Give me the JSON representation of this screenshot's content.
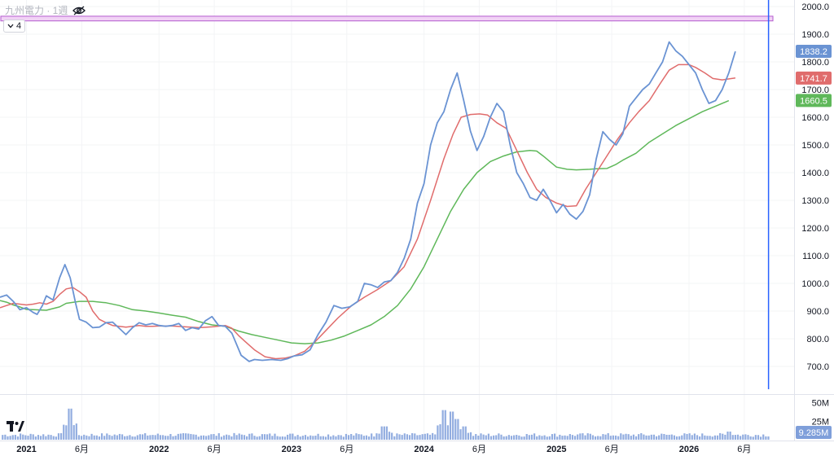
{
  "legend": {
    "symbol_text": "九州電力 · 1週",
    "collapse_count": "4"
  },
  "colors": {
    "price": "#6a93d3",
    "ma_short": "#e06c6c",
    "ma_long": "#5fb85a",
    "volume": "#7f9fda",
    "crosshair": "#2962ff",
    "highlight_fill": "#f1d2f5",
    "highlight_stroke": "#b35ccf"
  },
  "chart_data": {
    "type": "line",
    "x_axis": {
      "ticks": [
        {
          "label": "2021",
          "x": 2021.0
        },
        {
          "label": "6月",
          "x": 2021.417
        },
        {
          "label": "2022",
          "x": 2022.0
        },
        {
          "label": "6月",
          "x": 2022.417
        },
        {
          "label": "2023",
          "x": 2023.0
        },
        {
          "label": "6月",
          "x": 2023.417
        },
        {
          "label": "2024",
          "x": 2024.0
        },
        {
          "label": "6月",
          "x": 2024.417
        },
        {
          "label": "2025",
          "x": 2025.0
        },
        {
          "label": "6月",
          "x": 2025.417
        },
        {
          "label": "2026",
          "x": 2026.0
        },
        {
          "label": "6月",
          "x": 2026.417
        }
      ]
    },
    "y_axis": {
      "range": [
        620,
        2000
      ],
      "ticks": [
        {
          "label": "2000.0",
          "value": 2000
        },
        {
          "label": "1900.0",
          "value": 1900
        },
        {
          "label": "1800.0",
          "value": 1800
        },
        {
          "label": "1700.0",
          "value": 1700
        },
        {
          "label": "1600.0",
          "value": 1600
        },
        {
          "label": "1500.0",
          "value": 1500
        },
        {
          "label": "1400.0",
          "value": 1400
        },
        {
          "label": "1300.0",
          "value": 1300
        },
        {
          "label": "1200.0",
          "value": 1200
        },
        {
          "label": "1100.0",
          "value": 1100
        },
        {
          "label": "1000.0",
          "value": 1000
        },
        {
          "label": "900.0",
          "value": 900
        },
        {
          "label": "800.0",
          "value": 800
        },
        {
          "label": "700.0",
          "value": 700
        }
      ]
    },
    "volume_axis": {
      "max": 55,
      "ticks": [
        {
          "label": "50M",
          "value": 50
        },
        {
          "label": "25M",
          "value": 25
        }
      ]
    },
    "highlight_band": {
      "low": 1948,
      "high": 1965
    },
    "crosshair_x": 2026.6,
    "price_labels": [
      {
        "label": "1838.2",
        "value": 1838.2,
        "series": "price"
      },
      {
        "label": "1741.7",
        "value": 1741.7,
        "series": "ma_short"
      },
      {
        "label": "1660.5",
        "value": 1660.5,
        "series": "ma_long"
      }
    ],
    "volume_label": {
      "label": "9.285M",
      "value": 9.285
    },
    "series": [
      {
        "key": "price",
        "points": [
          [
            2020.8,
            950
          ],
          [
            2020.85,
            958
          ],
          [
            2020.9,
            935
          ],
          [
            2020.95,
            905
          ],
          [
            2021.0,
            912
          ],
          [
            2021.05,
            895
          ],
          [
            2021.08,
            888
          ],
          [
            2021.12,
            920
          ],
          [
            2021.15,
            955
          ],
          [
            2021.2,
            940
          ],
          [
            2021.25,
            1020
          ],
          [
            2021.29,
            1068
          ],
          [
            2021.33,
            1020
          ],
          [
            2021.37,
            930
          ],
          [
            2021.4,
            870
          ],
          [
            2021.45,
            860
          ],
          [
            2021.5,
            840
          ],
          [
            2021.55,
            842
          ],
          [
            2021.6,
            858
          ],
          [
            2021.65,
            860
          ],
          [
            2021.7,
            838
          ],
          [
            2021.75,
            815
          ],
          [
            2021.8,
            840
          ],
          [
            2021.85,
            858
          ],
          [
            2021.9,
            850
          ],
          [
            2021.95,
            855
          ],
          [
            2022.0,
            848
          ],
          [
            2022.05,
            845
          ],
          [
            2022.1,
            848
          ],
          [
            2022.15,
            855
          ],
          [
            2022.2,
            830
          ],
          [
            2022.25,
            840
          ],
          [
            2022.3,
            835
          ],
          [
            2022.35,
            865
          ],
          [
            2022.4,
            880
          ],
          [
            2022.45,
            848
          ],
          [
            2022.5,
            845
          ],
          [
            2022.55,
            820
          ],
          [
            2022.62,
            740
          ],
          [
            2022.68,
            718
          ],
          [
            2022.72,
            725
          ],
          [
            2022.78,
            722
          ],
          [
            2022.85,
            725
          ],
          [
            2022.92,
            722
          ],
          [
            2022.97,
            728
          ],
          [
            2023.02,
            738
          ],
          [
            2023.08,
            742
          ],
          [
            2023.14,
            760
          ],
          [
            2023.2,
            815
          ],
          [
            2023.26,
            860
          ],
          [
            2023.32,
            920
          ],
          [
            2023.38,
            910
          ],
          [
            2023.44,
            915
          ],
          [
            2023.5,
            935
          ],
          [
            2023.55,
            1000
          ],
          [
            2023.6,
            995
          ],
          [
            2023.65,
            985
          ],
          [
            2023.7,
            1005
          ],
          [
            2023.75,
            1010
          ],
          [
            2023.8,
            1040
          ],
          [
            2023.85,
            1090
          ],
          [
            2023.9,
            1160
          ],
          [
            2023.95,
            1290
          ],
          [
            2024.0,
            1360
          ],
          [
            2024.05,
            1500
          ],
          [
            2024.1,
            1580
          ],
          [
            2024.15,
            1620
          ],
          [
            2024.2,
            1700
          ],
          [
            2024.25,
            1760
          ],
          [
            2024.3,
            1660
          ],
          [
            2024.35,
            1550
          ],
          [
            2024.4,
            1480
          ],
          [
            2024.45,
            1530
          ],
          [
            2024.5,
            1600
          ],
          [
            2024.55,
            1650
          ],
          [
            2024.6,
            1620
          ],
          [
            2024.65,
            1500
          ],
          [
            2024.7,
            1400
          ],
          [
            2024.75,
            1360
          ],
          [
            2024.8,
            1310
          ],
          [
            2024.85,
            1300
          ],
          [
            2024.9,
            1340
          ],
          [
            2024.95,
            1300
          ],
          [
            2025.0,
            1255
          ],
          [
            2025.05,
            1285
          ],
          [
            2025.1,
            1250
          ],
          [
            2025.15,
            1232
          ],
          [
            2025.2,
            1260
          ],
          [
            2025.25,
            1320
          ],
          [
            2025.3,
            1450
          ],
          [
            2025.35,
            1548
          ],
          [
            2025.4,
            1520
          ],
          [
            2025.45,
            1500
          ],
          [
            2025.5,
            1540
          ],
          [
            2025.55,
            1640
          ],
          [
            2025.6,
            1670
          ],
          [
            2025.65,
            1700
          ],
          [
            2025.7,
            1720
          ],
          [
            2025.75,
            1760
          ],
          [
            2025.8,
            1800
          ],
          [
            2025.85,
            1872
          ],
          [
            2025.9,
            1840
          ],
          [
            2025.95,
            1820
          ],
          [
            2026.0,
            1790
          ],
          [
            2026.05,
            1760
          ],
          [
            2026.1,
            1700
          ],
          [
            2026.15,
            1650
          ],
          [
            2026.2,
            1660
          ],
          [
            2026.25,
            1700
          ],
          [
            2026.3,
            1760
          ],
          [
            2026.35,
            1838
          ]
        ]
      },
      {
        "key": "ma_short",
        "points": [
          [
            2020.8,
            912
          ],
          [
            2020.85,
            920
          ],
          [
            2020.9,
            928
          ],
          [
            2020.95,
            925
          ],
          [
            2021.0,
            922
          ],
          [
            2021.05,
            925
          ],
          [
            2021.1,
            930
          ],
          [
            2021.15,
            925
          ],
          [
            2021.2,
            935
          ],
          [
            2021.25,
            960
          ],
          [
            2021.3,
            980
          ],
          [
            2021.35,
            985
          ],
          [
            2021.4,
            970
          ],
          [
            2021.45,
            950
          ],
          [
            2021.5,
            900
          ],
          [
            2021.55,
            870
          ],
          [
            2021.6,
            858
          ],
          [
            2021.65,
            848
          ],
          [
            2021.7,
            845
          ],
          [
            2021.75,
            842
          ],
          [
            2021.8,
            845
          ],
          [
            2021.85,
            848
          ],
          [
            2021.9,
            845
          ],
          [
            2021.95,
            845
          ],
          [
            2022.0,
            846
          ],
          [
            2022.1,
            846
          ],
          [
            2022.2,
            843
          ],
          [
            2022.3,
            840
          ],
          [
            2022.4,
            843
          ],
          [
            2022.5,
            848
          ],
          [
            2022.55,
            838
          ],
          [
            2022.6,
            812
          ],
          [
            2022.65,
            790
          ],
          [
            2022.72,
            760
          ],
          [
            2022.8,
            735
          ],
          [
            2022.88,
            728
          ],
          [
            2022.95,
            730
          ],
          [
            2023.02,
            738
          ],
          [
            2023.1,
            755
          ],
          [
            2023.18,
            790
          ],
          [
            2023.26,
            830
          ],
          [
            2023.35,
            875
          ],
          [
            2023.45,
            918
          ],
          [
            2023.55,
            950
          ],
          [
            2023.65,
            978
          ],
          [
            2023.75,
            1010
          ],
          [
            2023.85,
            1060
          ],
          [
            2023.95,
            1160
          ],
          [
            2024.05,
            1300
          ],
          [
            2024.15,
            1450
          ],
          [
            2024.22,
            1540
          ],
          [
            2024.28,
            1600
          ],
          [
            2024.35,
            1610
          ],
          [
            2024.42,
            1612
          ],
          [
            2024.48,
            1608
          ],
          [
            2024.55,
            1580
          ],
          [
            2024.62,
            1560
          ],
          [
            2024.7,
            1480
          ],
          [
            2024.78,
            1400
          ],
          [
            2024.85,
            1340
          ],
          [
            2024.92,
            1310
          ],
          [
            2025.0,
            1290
          ],
          [
            2025.08,
            1278
          ],
          [
            2025.15,
            1280
          ],
          [
            2025.22,
            1340
          ],
          [
            2025.3,
            1400
          ],
          [
            2025.38,
            1460
          ],
          [
            2025.46,
            1520
          ],
          [
            2025.55,
            1580
          ],
          [
            2025.62,
            1620
          ],
          [
            2025.7,
            1660
          ],
          [
            2025.78,
            1720
          ],
          [
            2025.85,
            1770
          ],
          [
            2025.92,
            1790
          ],
          [
            2026.0,
            1790
          ],
          [
            2026.05,
            1780
          ],
          [
            2026.12,
            1760
          ],
          [
            2026.18,
            1740
          ],
          [
            2026.25,
            1735
          ],
          [
            2026.35,
            1742
          ]
        ]
      },
      {
        "key": "ma_long",
        "points": [
          [
            2020.8,
            938
          ],
          [
            2020.85,
            932
          ],
          [
            2020.9,
            922
          ],
          [
            2020.95,
            915
          ],
          [
            2021.0,
            906
          ],
          [
            2021.05,
            905
          ],
          [
            2021.15,
            903
          ],
          [
            2021.25,
            915
          ],
          [
            2021.3,
            928
          ],
          [
            2021.4,
            935
          ],
          [
            2021.5,
            935
          ],
          [
            2021.6,
            930
          ],
          [
            2021.7,
            920
          ],
          [
            2021.8,
            905
          ],
          [
            2021.9,
            900
          ],
          [
            2022.0,
            893
          ],
          [
            2022.1,
            885
          ],
          [
            2022.2,
            878
          ],
          [
            2022.3,
            862
          ],
          [
            2022.4,
            850
          ],
          [
            2022.5,
            845
          ],
          [
            2022.6,
            828
          ],
          [
            2022.7,
            815
          ],
          [
            2022.8,
            805
          ],
          [
            2022.9,
            795
          ],
          [
            2023.0,
            785
          ],
          [
            2023.1,
            782
          ],
          [
            2023.2,
            785
          ],
          [
            2023.3,
            795
          ],
          [
            2023.4,
            810
          ],
          [
            2023.5,
            830
          ],
          [
            2023.6,
            850
          ],
          [
            2023.7,
            880
          ],
          [
            2023.8,
            920
          ],
          [
            2023.9,
            980
          ],
          [
            2024.0,
            1060
          ],
          [
            2024.1,
            1160
          ],
          [
            2024.2,
            1260
          ],
          [
            2024.3,
            1340
          ],
          [
            2024.4,
            1400
          ],
          [
            2024.5,
            1440
          ],
          [
            2024.6,
            1460
          ],
          [
            2024.7,
            1475
          ],
          [
            2024.8,
            1480
          ],
          [
            2024.85,
            1478
          ],
          [
            2024.9,
            1460
          ],
          [
            2024.95,
            1440
          ],
          [
            2025.0,
            1420
          ],
          [
            2025.08,
            1412
          ],
          [
            2025.15,
            1410
          ],
          [
            2025.25,
            1412
          ],
          [
            2025.3,
            1414
          ],
          [
            2025.38,
            1415
          ],
          [
            2025.45,
            1430
          ],
          [
            2025.5,
            1445
          ],
          [
            2025.6,
            1470
          ],
          [
            2025.7,
            1510
          ],
          [
            2025.8,
            1540
          ],
          [
            2025.9,
            1570
          ],
          [
            2026.0,
            1595
          ],
          [
            2026.1,
            1620
          ],
          [
            2026.2,
            1640
          ],
          [
            2026.3,
            1660
          ]
        ]
      }
    ],
    "volume": {
      "seed": 7,
      "base": 4,
      "spikes": [
        [
          2021.33,
          42
        ],
        [
          2023.7,
          18
        ],
        [
          2024.15,
          40
        ],
        [
          2024.2,
          38
        ],
        [
          2024.25,
          28
        ],
        [
          2024.3,
          18
        ],
        [
          2026.3,
          11
        ]
      ]
    }
  }
}
